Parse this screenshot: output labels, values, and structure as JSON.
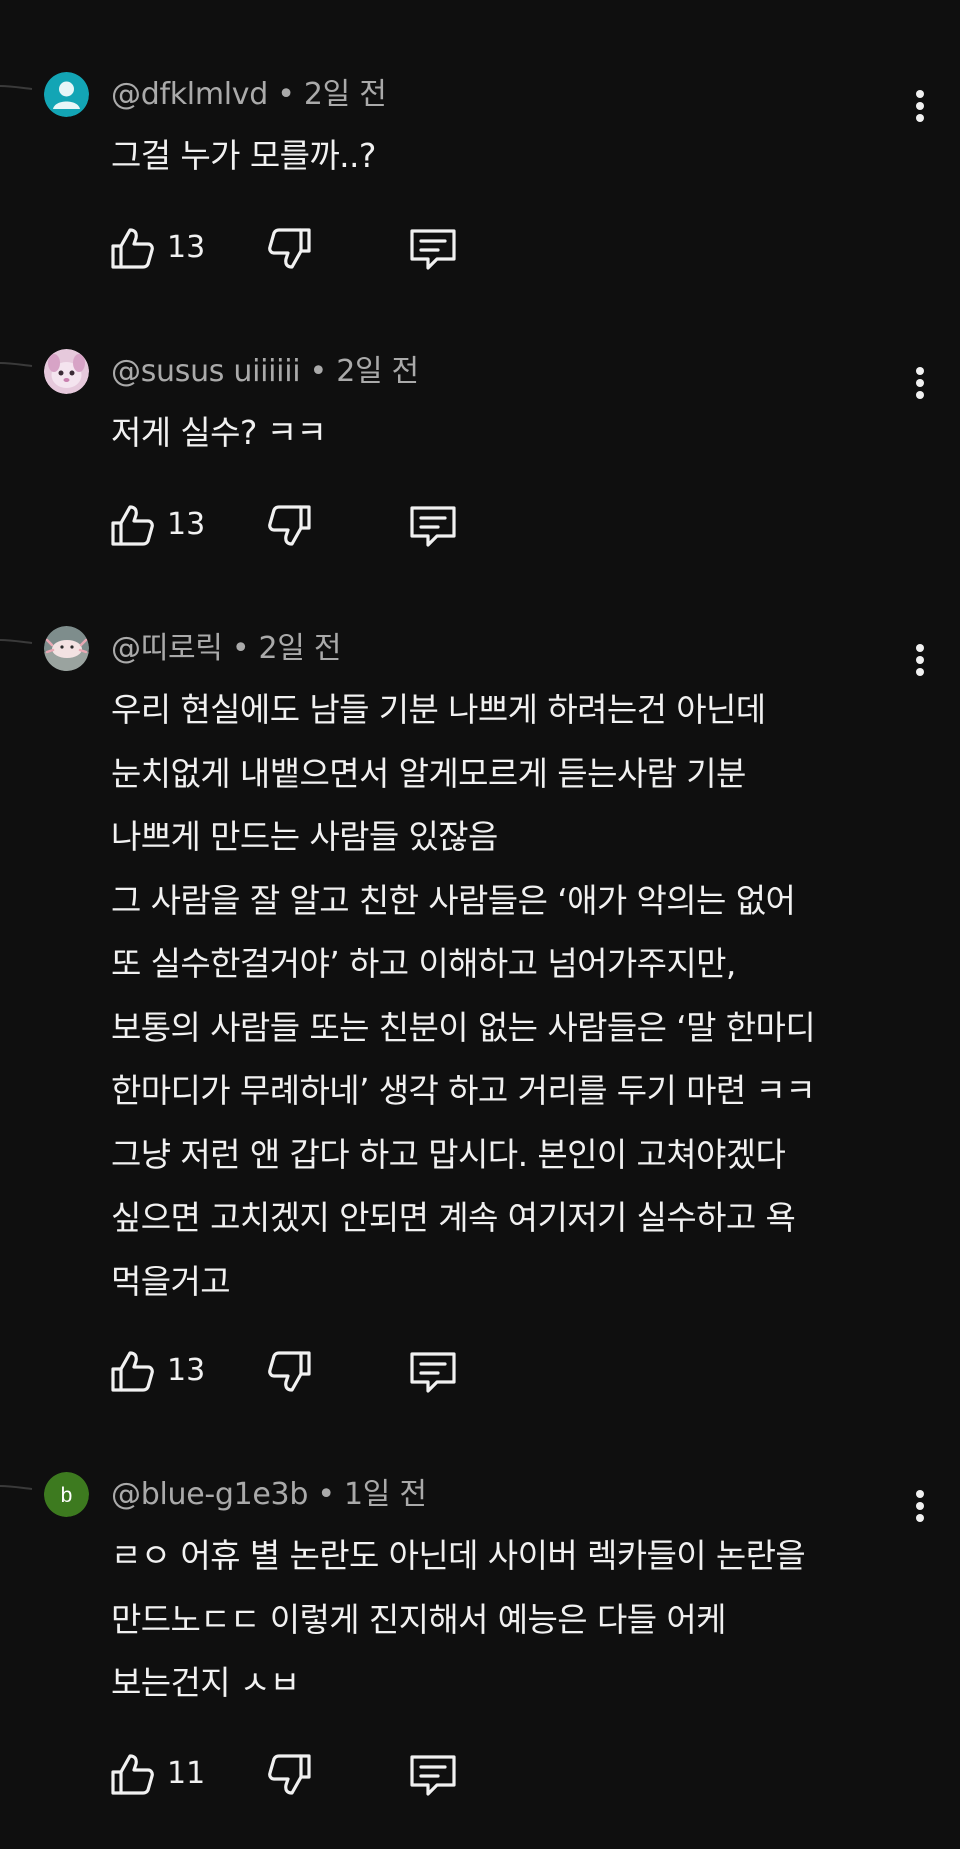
{
  "comments": [
    {
      "author": "@dfklmlvd",
      "separator": "•",
      "time": "2일 전",
      "avatar": {
        "type": "default-person",
        "bg": "#13a5b5"
      },
      "lines": [
        "그걸 누가 모를까..?"
      ],
      "likes": "13"
    },
    {
      "author": "@susus uiiiiii",
      "separator": "•",
      "time": "2일 전",
      "avatar": {
        "type": "photo-pink-creature",
        "bg": "#e6c9dc"
      },
      "lines": [
        "저게 실수? ㅋㅋ"
      ],
      "likes": "13"
    },
    {
      "author": "@띠로릭",
      "separator": "•",
      "time": "2일 전",
      "avatar": {
        "type": "photo-axolotl",
        "bg": "#dcd6cf"
      },
      "lines": [
        "우리 현실에도 남들 기분 나쁘게 하려는건 아닌데",
        "눈치없게 내뱉으면서 알게모르게 듣는사람 기분",
        "나쁘게 만드는 사람들 있잖음",
        "그 사람을 잘 알고 친한 사람들은 ‘애가 악의는 없어",
        "또 실수한걸거야’ 하고 이해하고 넘어가주지만,",
        "보통의 사람들 또는 친분이 없는 사람들은 ‘말 한마디",
        "한마디가 무례하네’ 생각 하고 거리를 두기 마련 ㅋㅋ",
        "그냥 저런 앤 갑다 하고 맙시다. 본인이 고쳐야겠다",
        "싶으면 고치겠지 안되면 계속 여기저기 실수하고 욕",
        "먹을거고"
      ],
      "likes": "13"
    },
    {
      "author": "@blue-g1e3b",
      "separator": "•",
      "time": "1일 전",
      "avatar": {
        "type": "letter",
        "letter": "b",
        "bg": "#3d7a1f"
      },
      "lines": [
        "ㄹㅇ 어휴 별 논란도 아닌데 사이버 렉카들이 논란을",
        "만드노ㄷㄷ 이렇게 진지해서 예능은 다들 어케",
        "보는건지 ㅅㅂ"
      ],
      "likes": "11"
    }
  ],
  "icons": {
    "like": "thumbs-up-icon",
    "dislike": "thumbs-down-icon",
    "reply": "reply-comment-icon",
    "more": "more-vertical-icon"
  },
  "colors": {
    "background": "#0f0f0f",
    "text": "#f1f1f1",
    "meta": "#aaaaaa"
  }
}
